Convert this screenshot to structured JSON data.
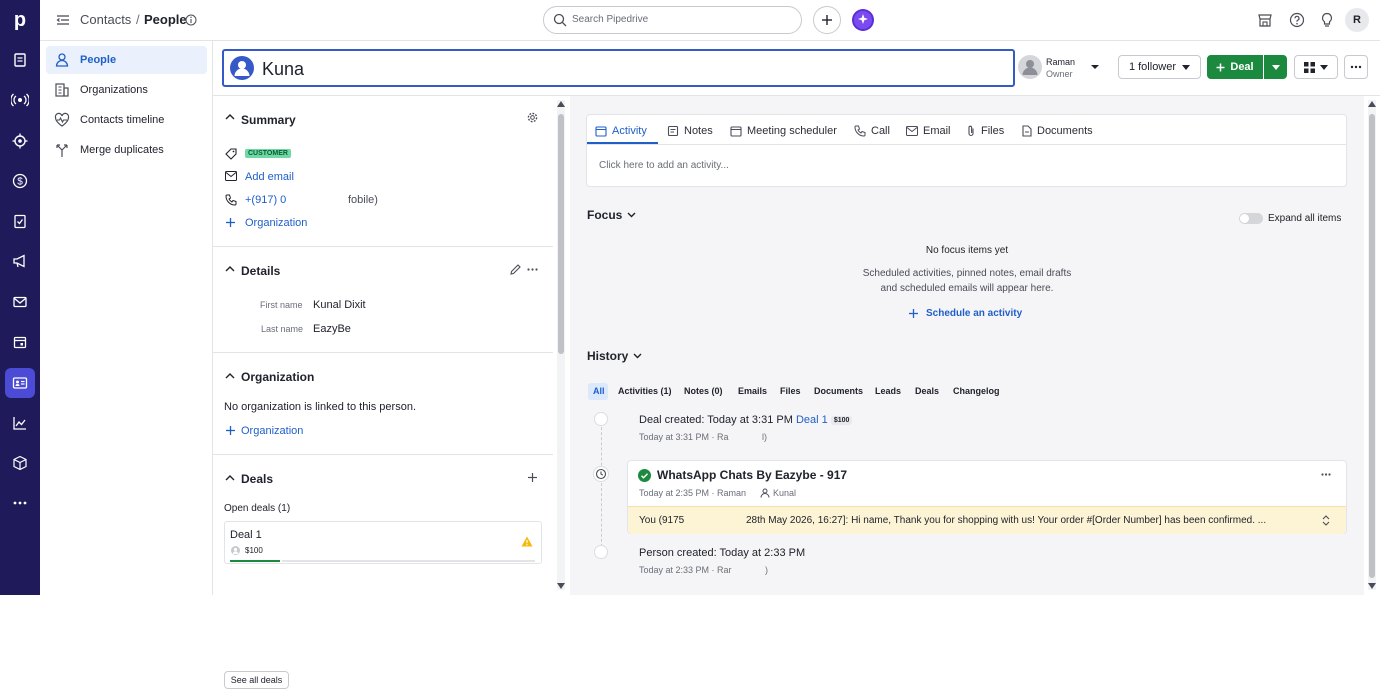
{
  "rail": {
    "logo": "p",
    "icons": [
      "leads-icon",
      "broadcast-icon",
      "target-icon",
      "dollar-icon",
      "tasks-icon",
      "megaphone-icon",
      "mail-icon",
      "calendar-icon",
      "contacts-icon",
      "chart-icon",
      "box-icon",
      "more-icon"
    ],
    "active_icon": "contacts-icon"
  },
  "topbar": {
    "breadcrumb_parent": "Contacts",
    "breadcrumb_sep": "/",
    "breadcrumb_current": "People",
    "search_placeholder": "Search Pipedrive",
    "avatar_initial": "R"
  },
  "leftnav": {
    "items": [
      {
        "label": "People",
        "icon": "person-icon",
        "active": true
      },
      {
        "label": "Organizations",
        "icon": "building-icon",
        "active": false
      },
      {
        "label": "Contacts timeline",
        "icon": "heart-pulse-icon",
        "active": false
      },
      {
        "label": "Merge duplicates",
        "icon": "merge-icon",
        "active": false
      }
    ]
  },
  "header": {
    "person_name": "Kuna",
    "owner_name": "Raman",
    "owner_label": "Owner",
    "follower_label": "1 follower",
    "deal_button": "Deal",
    "accent": "#1b8a3e"
  },
  "summary": {
    "title": "Summary",
    "tag": "CUSTOMER",
    "add_email": "Add email",
    "phone": "+(917) 0",
    "phone_type": "fobile)",
    "organization_link": "Organization"
  },
  "details": {
    "title": "Details",
    "first_name_label": "First name",
    "first_name": "Kunal Dixit",
    "last_name_label": "Last name",
    "last_name": "EazyBe"
  },
  "organization": {
    "title": "Organization",
    "empty_text": "No organization is linked to this person.",
    "link": "Organization"
  },
  "deals": {
    "title": "Deals",
    "open_deals": "Open deals (1)",
    "deal_name": "Deal 1",
    "deal_value": "$100",
    "see_all": "See all deals"
  },
  "activity_tabs": [
    {
      "label": "Activity",
      "icon": "calendar-check-icon",
      "active": true
    },
    {
      "label": "Notes",
      "icon": "note-icon",
      "active": false
    },
    {
      "label": "Meeting scheduler",
      "icon": "calendar-icon",
      "active": false
    },
    {
      "label": "Call",
      "icon": "phone-icon",
      "active": false
    },
    {
      "label": "Email",
      "icon": "mail-icon",
      "active": false
    },
    {
      "label": "Files",
      "icon": "paperclip-icon",
      "active": false
    },
    {
      "label": "Documents",
      "icon": "document-icon",
      "active": false
    }
  ],
  "activity_placeholder": "Click here to add an activity...",
  "focus": {
    "title": "Focus",
    "expand_label": "Expand all items",
    "empty_title": "No focus items yet",
    "empty_line1": "Scheduled activities, pinned notes, email drafts",
    "empty_line2": "and scheduled emails will appear here.",
    "schedule_link": "Schedule an activity"
  },
  "history": {
    "title": "History",
    "filters": [
      "All",
      "Activities (1)",
      "Notes (0)",
      "Emails",
      "Files",
      "Documents",
      "Leads",
      "Deals",
      "Changelog"
    ],
    "deal_created_label": "Deal created",
    "deal_created_when": ": Today at 3:31 PM",
    "deal_link": "Deal 1",
    "deal_badge": "$100",
    "deal_meta": "Today at 3:31 PM · Ra",
    "deal_meta_tail": "l)",
    "whatsapp_title": "WhatsApp Chats By Eazybe - 917",
    "whatsapp_meta_time": "Today at 2:35 PM · Raman",
    "whatsapp_meta_person": "Kunal",
    "whatsapp_msg_start": "You (9175",
    "whatsapp_msg_rest": "28th May 2026, 16:27]: Hi name, Thank you for shopping with us! Your order #[Order Number] has been confirmed. ...",
    "person_created_label": "Person created",
    "person_created_when": ": Today at 2:33 PM",
    "person_meta": "Today at 2:33 PM · Rar",
    "person_meta_tail": ")"
  }
}
